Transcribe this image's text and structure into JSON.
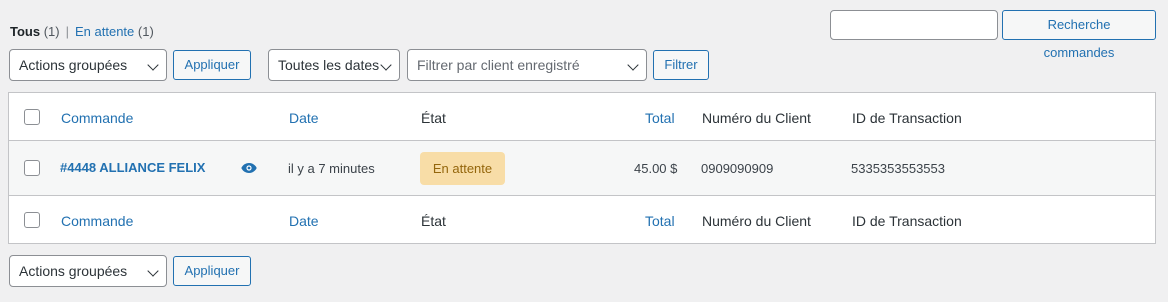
{
  "views": {
    "all_label": "Tous",
    "all_count": "(1)",
    "separator": "|",
    "pending_label": "En attente",
    "pending_count": "(1)"
  },
  "search": {
    "value": "",
    "button_label": "Recherche commandes"
  },
  "tablenav_top": {
    "bulk_actions": "Actions groupées",
    "apply_label": "Appliquer",
    "date_filter": "Toutes les dates",
    "customer_filter_placeholder": "Filtrer par client enregistré",
    "filter_label": "Filtrer"
  },
  "tablenav_bottom": {
    "bulk_actions": "Actions groupées",
    "apply_label": "Appliquer"
  },
  "columns": {
    "order": "Commande",
    "date": "Date",
    "status": "État",
    "total": "Total",
    "customer_number": "Numéro du Client",
    "transaction_id": "ID de Transaction"
  },
  "orders": [
    {
      "order": "#4448 ALLIANCE FELIX",
      "date": "il y a 7 minutes",
      "status": "En attente",
      "total": "45.00 $",
      "customer_number": "0909090909",
      "transaction_id": "5335353553553"
    }
  ],
  "colors": {
    "link": "#2271b1",
    "status_pending_bg": "#f8dda7",
    "status_pending_text": "#94660c",
    "page_bg": "#f0f0f1"
  },
  "icons": {
    "preview": "eye-icon",
    "select_arrow": "chevron-down-icon"
  }
}
